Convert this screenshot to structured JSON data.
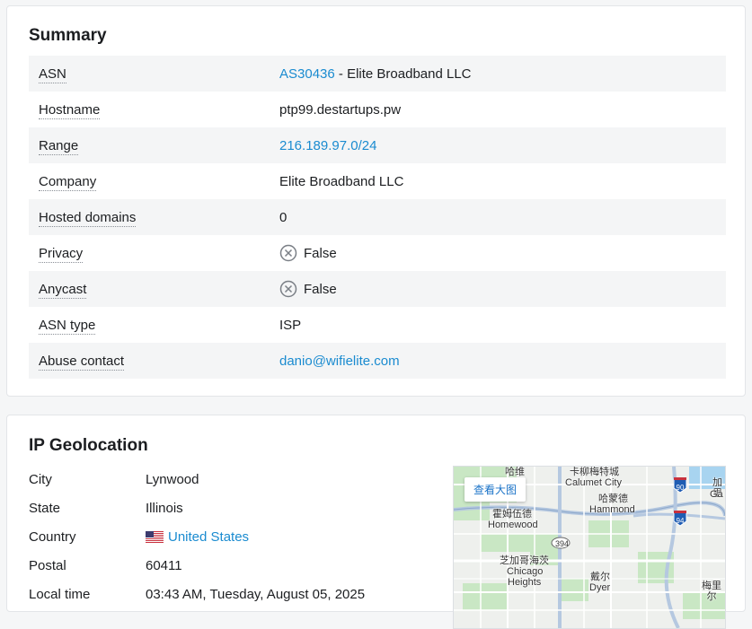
{
  "summary": {
    "title": "Summary",
    "asn": {
      "label": "ASN",
      "link": "AS30436",
      "rest": " - Elite Broadband LLC"
    },
    "hostname": {
      "label": "Hostname",
      "value": "ptp99.destartups.pw"
    },
    "range": {
      "label": "Range",
      "value": "216.189.97.0/24"
    },
    "company": {
      "label": "Company",
      "value": "Elite Broadband LLC"
    },
    "hosted_domains": {
      "label": "Hosted domains",
      "value": "0"
    },
    "privacy": {
      "label": "Privacy",
      "value": "False",
      "icon": "x-circle-icon"
    },
    "anycast": {
      "label": "Anycast",
      "value": "False",
      "icon": "x-circle-icon"
    },
    "asn_type": {
      "label": "ASN type",
      "value": "ISP"
    },
    "abuse_contact": {
      "label": "Abuse contact",
      "value": "danio@wifielite.com"
    }
  },
  "geo": {
    "title": "IP Geolocation",
    "city": {
      "label": "City",
      "value": "Lynwood"
    },
    "state": {
      "label": "State",
      "value": "Illinois"
    },
    "country": {
      "label": "Country",
      "value": "United States",
      "icon": "us-flag-icon"
    },
    "postal": {
      "label": "Postal",
      "value": "60411"
    },
    "local_time": {
      "label": "Local time",
      "value": "03:43 AM, Tuesday, August 05, 2025"
    }
  },
  "map": {
    "view_larger": "查看大图",
    "labels": {
      "calumet_cn": "卡柳梅特城",
      "calumet_en": "Calumet City",
      "hammond_cn": "哈蒙德",
      "hammond_en": "Hammond",
      "homewood_cn": "霍姆伍德",
      "homewood_en": "Homewood",
      "chicago_heights_cn": "芝加哥海茨",
      "chicago_heights_en1": "Chicago",
      "chicago_heights_en2": "Heights",
      "dyer_cn": "戴尔",
      "dyer_en": "Dyer",
      "gary_cn": "加里",
      "gary_en": "Ga",
      "merrillville_cn": "梅里尔",
      "top_cut": "哈维",
      "hwy_90": "90",
      "hwy_94": "94",
      "hwy_394": "394"
    },
    "colors": {
      "water": "#a8d4f0",
      "park": "#c9e7c4",
      "road": "#ffffff",
      "highway": "#b5c8e0"
    }
  }
}
